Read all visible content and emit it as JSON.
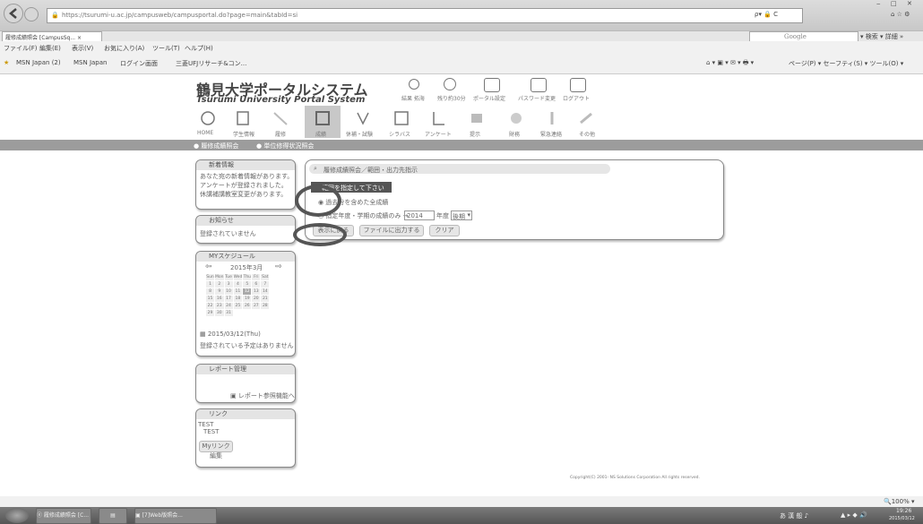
{
  "browser": {
    "url": "https://tsurumi-u.ac.jp/campusweb/campusportal.do?page=main&tabId=si",
    "tab_title": "履修成績照会 [CampusSq... ×",
    "search_placeholder": "Google",
    "menu": [
      "ファイル(F)",
      "編集(E)",
      "表示(V)",
      "お気に入り(A)",
      "ツール(T)",
      "ヘルプ(H)"
    ],
    "favorites": [
      "MSN Japan (2)",
      "MSN Japan",
      "ログイン画面",
      "三菱UFJリサーチ&コン..."
    ],
    "command_bar": "ページ(P) ▾  セーフティ(S) ▾  ツール(O) ▾",
    "zoom": "100%"
  },
  "portal": {
    "title_jp": "鶴見大学ポータルシステム",
    "title_en": "Tsurumi University Portal System",
    "top_links": [
      "結果 拓海",
      "残り約30分",
      "ポータル設定",
      "パスワード変更",
      "ログアウト"
    ],
    "menu": [
      "HOME",
      "学生情報",
      "履修",
      "成績",
      "休補・試験",
      "シラバス",
      "アンケート",
      "提示",
      "財務",
      "緊急連絡",
      "その他"
    ],
    "active_menu": "成績",
    "submenu": [
      "履修成績照会",
      "単位修得状況照会"
    ]
  },
  "sidebar": {
    "news": {
      "title": "新着情報",
      "lines": [
        "あなた宛の新着情報があります。",
        "アンケートが登録されました。",
        "休講補講教室変更があります。"
      ]
    },
    "notice": {
      "title": "お知らせ",
      "text": "登録されていません"
    },
    "schedule": {
      "title": "MYスケジュール",
      "month": "2015年3月",
      "weekdays": [
        "Sun",
        "Mon",
        "Tue",
        "Wed",
        "Thu",
        "Fri",
        "Sat"
      ],
      "days": [
        [
          "1",
          "2",
          "3",
          "4",
          "5",
          "6",
          "7"
        ],
        [
          "8",
          "9",
          "10",
          "11",
          "12",
          "13",
          "14"
        ],
        [
          "15",
          "16",
          "17",
          "18",
          "19",
          "20",
          "21"
        ],
        [
          "22",
          "23",
          "24",
          "25",
          "26",
          "27",
          "28"
        ],
        [
          "29",
          "30",
          "31",
          "",
          "",
          "",
          ""
        ]
      ],
      "date": "2015/03/12(Thu)",
      "no_plan": "登録されている予定はありません"
    },
    "report": {
      "title": "レポート管理",
      "link": "レポート参照機能へ"
    },
    "links": {
      "title": "リンク",
      "items": [
        "TEST",
        "TEST"
      ],
      "edit": "Myリンク編集"
    }
  },
  "main": {
    "breadcrumb": "履修成績照会／範囲・出力先指示",
    "instruction": "範囲を指定して下さい",
    "option1": "過去分を含めた全成績",
    "option2_pre": "指定年度・学期の成績のみ →",
    "year_value": "2014",
    "year_label": "年度",
    "term_value": "後期",
    "buttons": [
      "表示に戻る",
      "ファイルに出力する",
      "クリア"
    ],
    "copyright": "Copyright(C) 2001- NS Solutions Corporation All rights reserved."
  },
  "taskbar": {
    "tasks": [
      "履修成績照会 [C...",
      "",
      "[7]Web版照会..."
    ],
    "ime": "あ 漢 般 ♪",
    "time": "19:26",
    "date": "2015/03/12"
  }
}
